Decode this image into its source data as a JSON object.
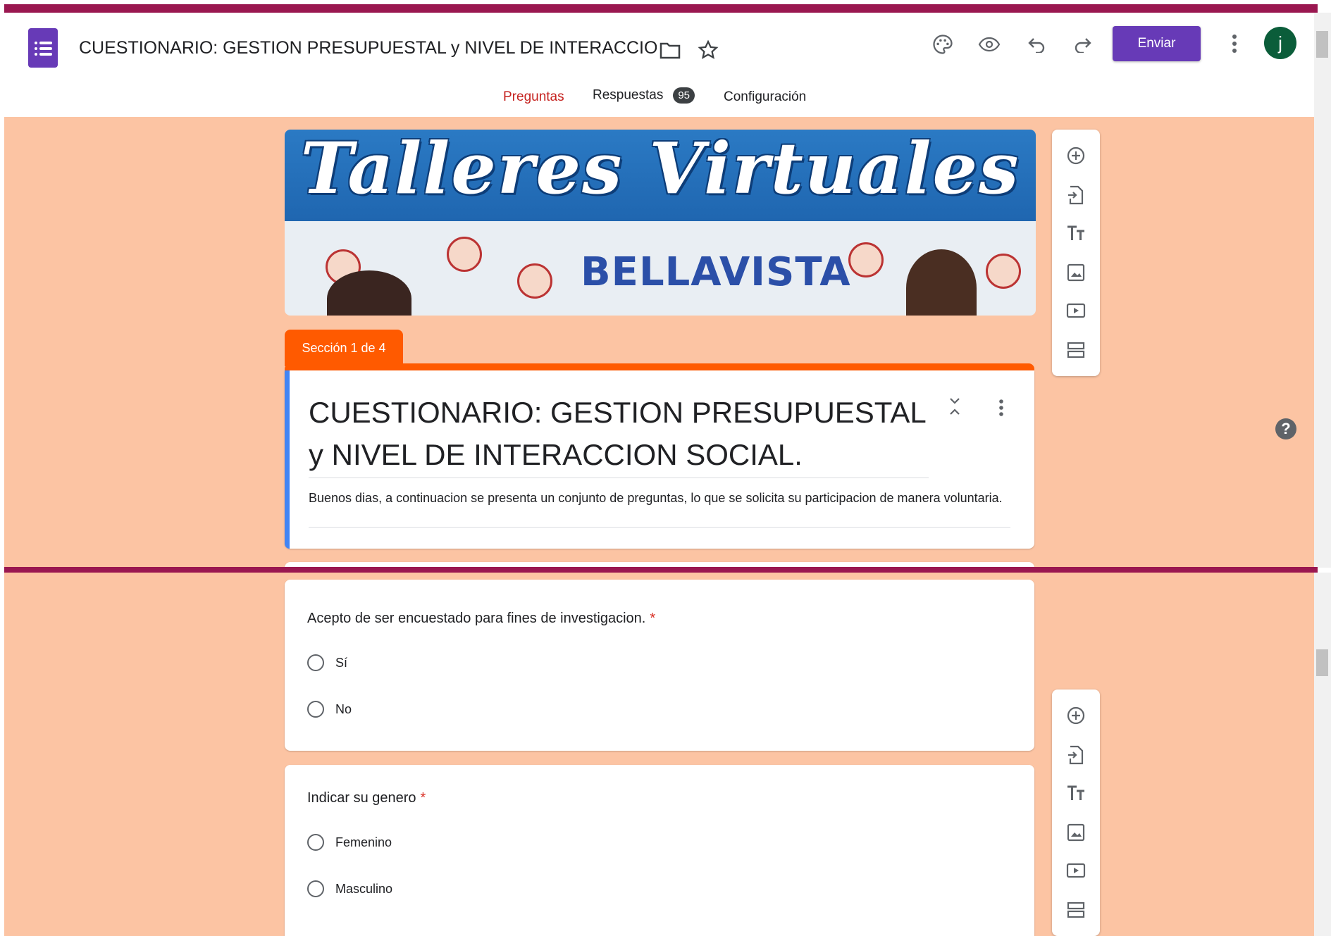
{
  "header": {
    "doc_title": "CUESTIONARIO: GESTION PRESUPUESTAL y NIVEL DE INTERACCION SO(",
    "send_label": "Enviar",
    "avatar_letter": "j",
    "icons": [
      "forms-logo-icon",
      "folder-icon",
      "star-icon",
      "palette-icon",
      "eye-icon",
      "undo-icon",
      "redo-icon",
      "more-vert-icon"
    ]
  },
  "tabs": {
    "questions": "Preguntas",
    "responses": "Respuestas",
    "responses_count": "95",
    "settings": "Configuración",
    "active": "questions"
  },
  "banner": {
    "title": "Talleres Virtuales",
    "subtitle": "BELLAVISTA"
  },
  "section": {
    "label": "Sección 1 de 4",
    "title": "CUESTIONARIO: GESTION PRESUPUESTAL y NIVEL DE INTERACCION SOCIAL.",
    "description": "Buenos dias, a continuacion se presenta un conjunto de preguntas, lo que se solicita su participacion de manera voluntaria."
  },
  "questions": [
    {
      "title": "Acepto de ser encuestado para fines de investigacion.",
      "required_mark": "*",
      "options": [
        "Sí",
        "No"
      ]
    },
    {
      "title": "Indicar su genero",
      "required_mark": "*",
      "options": [
        "Femenino",
        "Masculino"
      ]
    }
  ],
  "toolbar": [
    "add-question-icon",
    "import-questions-icon",
    "add-title-icon",
    "add-image-icon",
    "add-video-icon",
    "add-section-icon"
  ],
  "colors": {
    "accent": "#673ab7",
    "theme": "#ff5a00",
    "background": "#fcc4a3",
    "active_tab": "#c5221f",
    "frame": "#9a1750"
  }
}
